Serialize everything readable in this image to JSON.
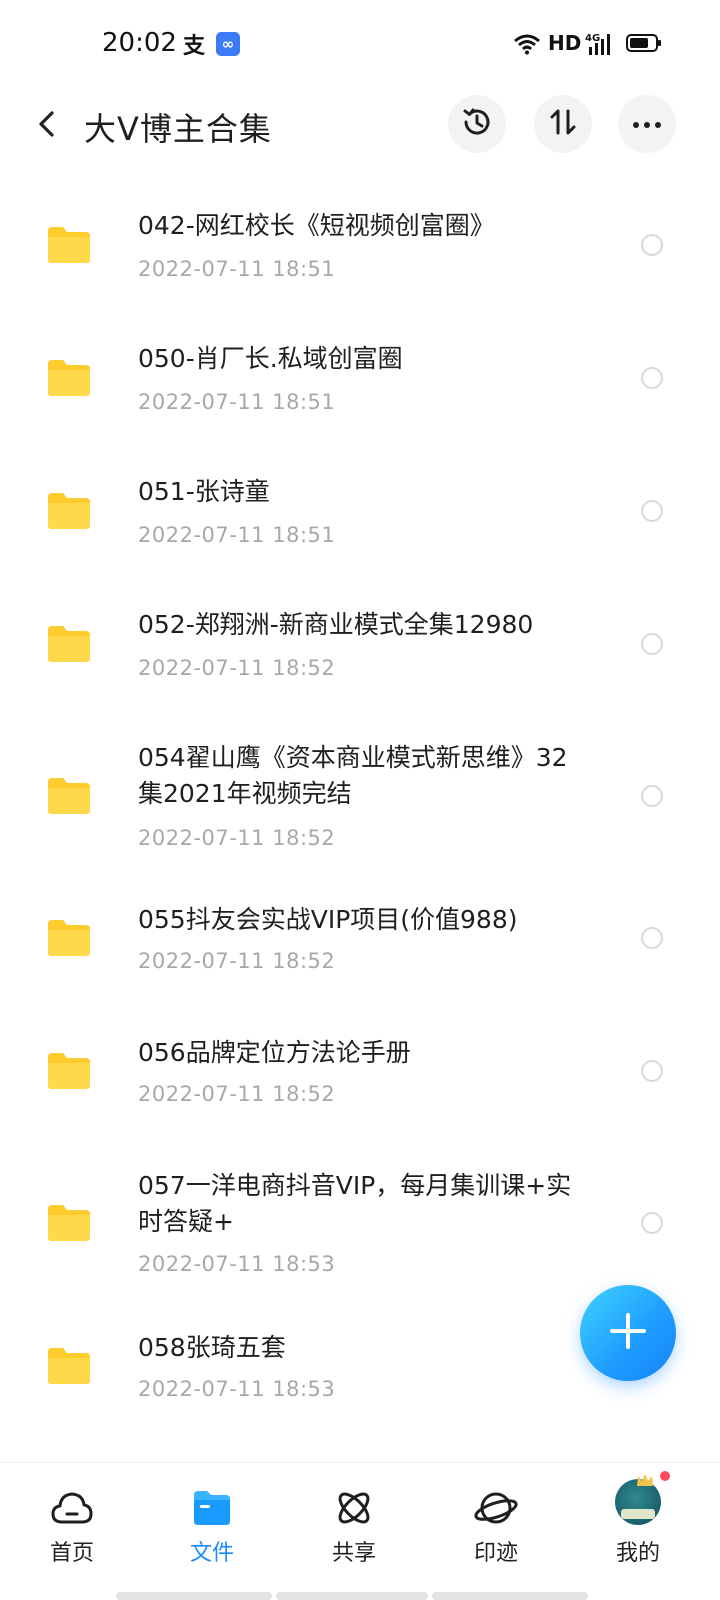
{
  "status_bar": {
    "time": "20:02",
    "alipay_icon": "支",
    "network_label": "HD",
    "icons": [
      "alipay-icon",
      "app-badge-icon",
      "wifi-icon",
      "signal-4g-icon",
      "battery-icon"
    ]
  },
  "header": {
    "title": "大V博主合集",
    "buttons": [
      "back-icon",
      "history-icon",
      "sort-icon",
      "more-icon"
    ]
  },
  "files": [
    {
      "name": "042-网红校长《短视频创富圈》",
      "date": "2022-07-11  18:51"
    },
    {
      "name": "050-肖厂长.私域创富圈",
      "date": "2022-07-11  18:51"
    },
    {
      "name": "051-张诗童",
      "date": "2022-07-11  18:51"
    },
    {
      "name": "052-郑翔洲-新商业模式全集12980",
      "date": "2022-07-11  18:52"
    },
    {
      "name": "054翟山鹰《资本商业模式新思维》32集2021年视频完结",
      "date": "2022-07-11  18:52"
    },
    {
      "name": "055抖友会实战VIP项目(价值988)",
      "date": "2022-07-11  18:52"
    },
    {
      "name": "056品牌定位方法论手册",
      "date": "2022-07-11  18:52"
    },
    {
      "name": "057一洋电商抖音VIP，每月集训课+实时答疑+",
      "date": "2022-07-11  18:53"
    },
    {
      "name": "058张琦五套",
      "date": "2022-07-11  18:53"
    }
  ],
  "bottom_nav": {
    "items": [
      {
        "label": "首页",
        "icon": "cloud-home-icon"
      },
      {
        "label": "文件",
        "icon": "folder-icon",
        "active": true
      },
      {
        "label": "共享",
        "icon": "atom-share-icon"
      },
      {
        "label": "印迹",
        "icon": "planet-icon"
      },
      {
        "label": "我的",
        "icon": "avatar"
      }
    ]
  },
  "colors": {
    "accent": "#1a8cff",
    "folder": "#ffd43b",
    "date_text": "#a6a8ad",
    "notification": "#ff4d5e"
  }
}
